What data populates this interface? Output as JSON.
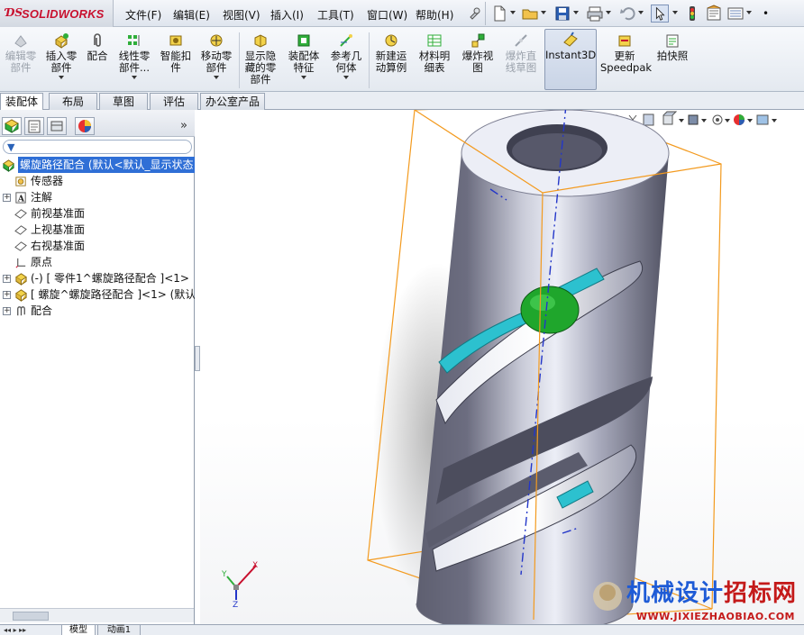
{
  "app": {
    "brand": "SOLIDWORKS"
  },
  "menu": [
    "文件(F)",
    "编辑(E)",
    "视图(V)",
    "插入(I)",
    "工具(T)",
    "窗口(W)",
    "帮助(H)"
  ],
  "command_manager": [
    {
      "label": "编辑零\n部件",
      "state": "dim"
    },
    {
      "label": "插入零\n部件",
      "dropdown": true
    },
    {
      "label": "配合"
    },
    {
      "label": "线性零\n部件...",
      "dropdown": true
    },
    {
      "label": "智能扣\n件"
    },
    {
      "label": "移动零\n部件",
      "dropdown": true
    },
    {
      "label": "显示隐\n藏的零\n部件"
    },
    {
      "label": "装配体\n特征",
      "dropdown": true
    },
    {
      "label": "参考几\n何体",
      "dropdown": true
    },
    {
      "label": "新建运\n动算例"
    },
    {
      "label": "材料明\n细表"
    },
    {
      "label": "爆炸视\n图"
    },
    {
      "label": "爆炸直\n线草图",
      "state": "dim"
    },
    {
      "label": "Instant3D",
      "state": "active"
    },
    {
      "label": "更新\nSpeedpak"
    },
    {
      "label": "拍快照"
    }
  ],
  "tabs": [
    "装配体",
    "布局",
    "草图",
    "评估",
    "办公室产品"
  ],
  "selected_tab": "装配体",
  "feature_tree": [
    {
      "label": "螺旋路径配合 (默认<默认_显示状态",
      "selected": true,
      "icon": "assembly-icon"
    },
    {
      "label": "传感器",
      "icon": "sensor-icon"
    },
    {
      "label": "注解",
      "icon": "annotation-icon",
      "expandable": true
    },
    {
      "label": "前视基准面",
      "icon": "plane-icon"
    },
    {
      "label": "上视基准面",
      "icon": "plane-icon"
    },
    {
      "label": "右视基准面",
      "icon": "plane-icon"
    },
    {
      "label": "原点",
      "icon": "origin-icon"
    },
    {
      "label": "(-) [ 零件1^螺旋路径配合 ]<1>",
      "icon": "part-icon",
      "expandable": true
    },
    {
      "label": "[ 螺旋^螺旋路径配合 ]<1> (默认",
      "icon": "part-icon",
      "expandable": true
    },
    {
      "label": "配合",
      "icon": "mates-icon",
      "expandable": true
    }
  ],
  "bottom_tabs": [
    "模型",
    "动画1"
  ],
  "triad": {
    "x": "X",
    "y": "Y",
    "z": "Z"
  },
  "watermark": {
    "cn_a": "机械设计",
    "cn_b": "招标网",
    "url": "WWW.JIXIEZHAOBIAO.COM"
  },
  "colors": {
    "accent": "#2f6fd6",
    "brand": "#c8102e",
    "bbox": "#f39a1e",
    "axis": "#2336c9",
    "ball": "#1fa62c",
    "slot": "#2cc1cf"
  }
}
